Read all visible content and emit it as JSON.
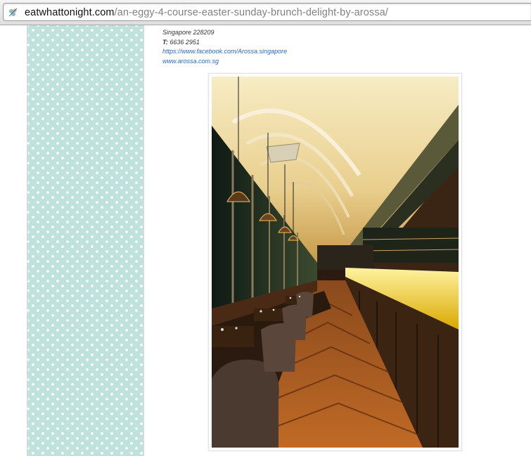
{
  "browser": {
    "url_domain": "eatwhattonight.com",
    "url_path": "/an-eggy-4-course-easter-sunday-brunch-delight-by-arossa/",
    "favicon": "site-favicon-icon"
  },
  "article": {
    "address_line": "Singapore 228209",
    "phone_label": "T:",
    "phone_number": "6636 2951",
    "facebook_link": "https://www.facebook.com/Arossa.singapore",
    "website_link": "www.arossa.com.sg"
  },
  "colors": {
    "sidebar_teal": "#bfe3dc",
    "link_blue": "#2a66c4",
    "url_path_gray": "#808080"
  }
}
